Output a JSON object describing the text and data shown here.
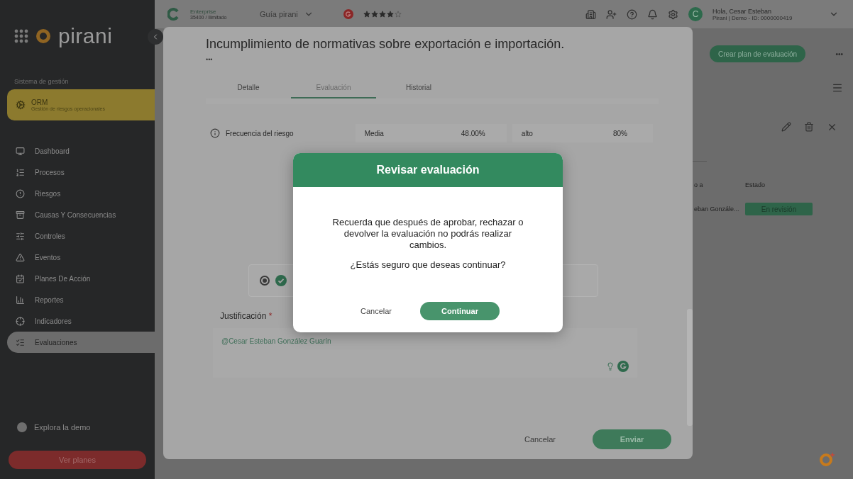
{
  "sidebar": {
    "logo": "pirani",
    "section_label": "Sistema de gestión",
    "module": {
      "name": "ORM",
      "description": "Gestión de riesgos operacionales"
    },
    "items": [
      {
        "label": "Dashboard",
        "selected": false
      },
      {
        "label": "Procesos",
        "selected": false
      },
      {
        "label": "Riesgos",
        "selected": false
      },
      {
        "label": "Causas Y Consecuencias",
        "selected": false
      },
      {
        "label": "Controles",
        "selected": false
      },
      {
        "label": "Eventos",
        "selected": false
      },
      {
        "label": "Planes De Acción",
        "selected": false
      },
      {
        "label": "Reportes",
        "selected": false
      },
      {
        "label": "Indicadores",
        "selected": false
      },
      {
        "label": "Evaluaciones",
        "selected": true
      }
    ],
    "demo_link": "Explora la demo",
    "plans_button": "Ver planes"
  },
  "topbar": {
    "plan": {
      "name": "Enterprise",
      "detail": "35400 / Ilimitado"
    },
    "guide": "Guía pirani",
    "rating": {
      "stars": 4
    },
    "user": {
      "initial": "C",
      "greeting": "Hola, Cesar Esteban",
      "detail": "Pirani | Demo - ID: 0000000419"
    }
  },
  "background": {
    "primary_button": "Crear plan de evaluación",
    "more": "•••",
    "table": {
      "columns": [
        "o a",
        "Estado"
      ],
      "rows": [
        {
          "cells": [
            "eban Gonzále...",
            "En revisión"
          ]
        }
      ]
    }
  },
  "detail_panel": {
    "title": "Incumplimiento de normativas sobre exportación e importación.",
    "more": "•••",
    "tabs": [
      {
        "label": "Detalle",
        "selected": false
      },
      {
        "label": "Evaluación",
        "selected": true
      },
      {
        "label": "Historial",
        "selected": false
      }
    ],
    "risk_row": {
      "label": "Frecuencia del riesgo",
      "inherent": {
        "level": "Media",
        "value": "48.00%"
      },
      "residual": {
        "level": "alto",
        "value": "80%"
      }
    },
    "option_card": {
      "selected": true
    },
    "justification": {
      "label": "Justificación",
      "required": true,
      "required_mark": "*",
      "value": "@Cesar Esteban González Guarín"
    },
    "buttons": {
      "cancel": "Cancelar",
      "submit": "Enviar"
    }
  },
  "dialog": {
    "title": "Revisar evaluación",
    "message": "Recuerda que después de aprobar, rechazar o devolver la evaluación no podrás realizar cambios.",
    "question": "¿Estás seguro que deseas continuar?",
    "cancel": "Cancelar",
    "confirm": "Continuar"
  }
}
